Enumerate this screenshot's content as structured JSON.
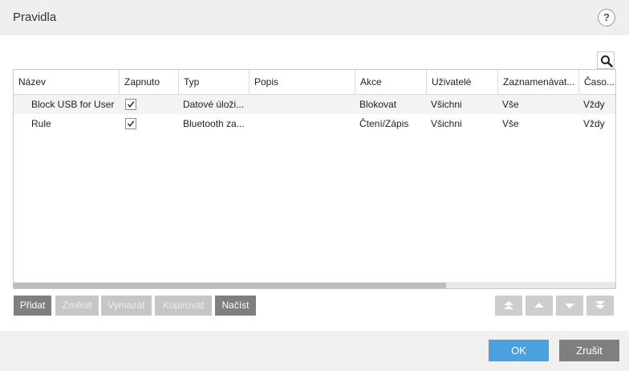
{
  "window": {
    "title": "Pravidla",
    "help_label": "?"
  },
  "table": {
    "columns": [
      "Název",
      "Zapnuto",
      "Typ",
      "Popis",
      "Akce",
      "Uživatelé",
      "Zaznamenávat...",
      "Časo..."
    ],
    "rows": [
      {
        "name": "Block USB for User",
        "enabled": true,
        "type": "Datové úloži...",
        "description": "",
        "action": "Blokovat",
        "users": "Všichni",
        "log": "Vše",
        "time": "Vždy"
      },
      {
        "name": "Rule",
        "enabled": true,
        "type": "Bluetooth za...",
        "description": "",
        "action": "Čtení/Zápis",
        "users": "Všichni",
        "log": "Vše",
        "time": "Vždy"
      }
    ]
  },
  "toolbar": {
    "add": "Přidat",
    "edit": "Změnit",
    "delete": "Vymazat",
    "copy": "Kopírovat",
    "load": "Načíst"
  },
  "footer": {
    "ok": "OK",
    "cancel": "Zrušit"
  },
  "icons": {
    "search": "search-icon",
    "help": "help-icon",
    "move_top": "move-top-icon",
    "move_up": "move-up-icon",
    "move_down": "move-down-icon",
    "move_bottom": "move-bottom-icon",
    "checkmark": "checkmark-icon"
  },
  "colors": {
    "accent": "#4aa1de",
    "button_gray": "#7f7f7f",
    "disabled_gray": "#c6c6c6"
  }
}
